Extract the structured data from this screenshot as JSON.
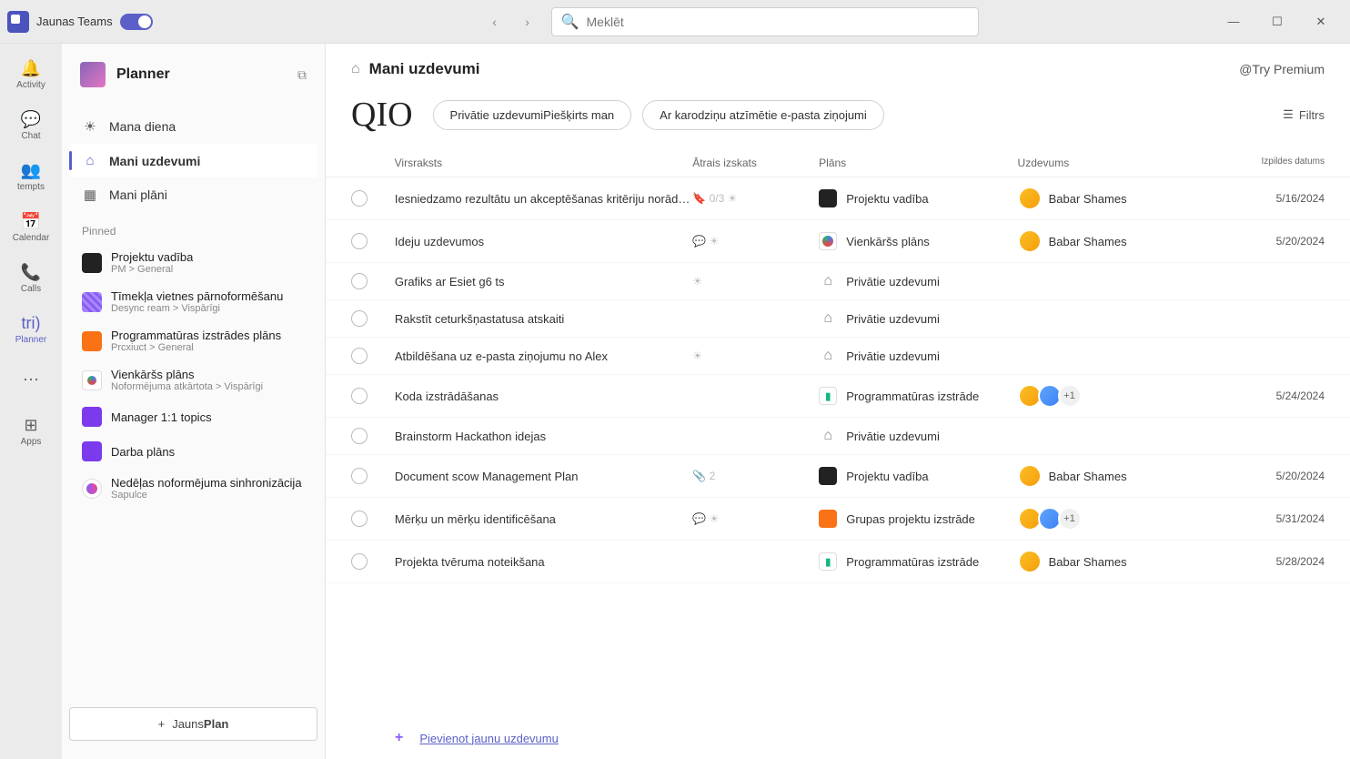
{
  "titlebar": {
    "teams_label": "Jaunas Teams",
    "search_placeholder": "Meklēt"
  },
  "rail": [
    {
      "label": "Activity",
      "icon": "🔔"
    },
    {
      "label": "Chat",
      "icon": "💬"
    },
    {
      "label": "tempts",
      "icon": "👥"
    },
    {
      "label": "Calendar",
      "icon": "📅"
    },
    {
      "label": "Calls",
      "icon": "📞"
    },
    {
      "label": "Planner",
      "icon": "tri)",
      "active": true
    },
    {
      "label": "",
      "icon": "⋯"
    },
    {
      "label": "Apps",
      "icon": "⊞"
    }
  ],
  "sidebar": {
    "title": "Planner",
    "nav": [
      {
        "label": "Mana diena",
        "icon": "☀"
      },
      {
        "label": "Mani uzdevumi",
        "icon": "⌂",
        "active": true
      },
      {
        "label": "Mani plāni",
        "icon": "▦"
      }
    ],
    "pinned_label": "Pinned",
    "pinned": [
      {
        "title": "Projektu vadība",
        "sub": "PM &gt; General",
        "cls": "black"
      },
      {
        "title": "Tīmekļa vietnes pārnoformēšanu",
        "sub": "Desync ream > Vispārīgi",
        "cls": "purple"
      },
      {
        "title": "Programmatūras izstrādes plāns",
        "sub": "Prcxiuct &gt; General",
        "cls": "orange"
      },
      {
        "title": "Vienkāršs plāns",
        "sub": "Noformējuma atkārtota &gt; Vispārīgi",
        "cls": "white"
      },
      {
        "title": "Manager 1:1 topics",
        "sub": "",
        "cls": "violet"
      },
      {
        "title": "Darba plāns",
        "sub": "",
        "cls": "violet"
      },
      {
        "title": "Nedēļas noformējuma sinhronizācija",
        "sub": "Sapulce",
        "cls": "circle"
      }
    ],
    "new_plan_prefix": "Jauns",
    "new_plan_suffix": "Plan"
  },
  "content": {
    "title": "Mani uzdevumi",
    "premium": "@Try Premium",
    "qio": "QIO",
    "pill1": "Privātie uzdevumiPiešķirts man",
    "pill2": "Ar karodziņu atzīmētie e-pasta ziņojumi",
    "filter": "Filtrs",
    "columns": {
      "title": "Virsraksts",
      "quick": "Ātrais izskats",
      "plan": "Plāns",
      "assign": "Uzdevums",
      "date": "Izpildes datums"
    },
    "tasks": [
      {
        "title": "Iesniedzamo rezultātu un akceptēšanas kritēriju norādīšana",
        "quick": "🔖 0/3 ☀",
        "plan": "Projektu vadība",
        "plan_cls": "black",
        "assignee": "Babar Shames",
        "avatars": 1,
        "date": "5/16/2024"
      },
      {
        "title": "Ideju uzdevumos",
        "quick": "💬 ☀",
        "plan": "Vienkāršs plāns",
        "plan_cls": "swirl",
        "assignee": "Babar Shames",
        "avatars": 1,
        "date": "5/20/2024"
      },
      {
        "title": "Grafiks ar Esiet g6 ts",
        "quick": "☀",
        "plan": "Privātie uzdevumi",
        "plan_cls": "home",
        "assignee": "",
        "avatars": 0,
        "date": ""
      },
      {
        "title": "Rakstīt ceturkšņastatusa atskaiti",
        "quick": "",
        "plan": "Privātie uzdevumi",
        "plan_cls": "home",
        "assignee": "",
        "avatars": 0,
        "date": ""
      },
      {
        "title": "Atbildēšana uz e-pasta ziņojumu no Alex",
        "quick": "☀",
        "plan": "Privātie uzdevumi",
        "plan_cls": "home",
        "assignee": "",
        "avatars": 0,
        "date": ""
      },
      {
        "title": "Koda izstrādāšanas",
        "quick": "",
        "plan": "Programmatūras izstrāde",
        "plan_cls": "green",
        "assignee": "",
        "avatars": 2,
        "more": "+1",
        "date": "5/24/2024"
      },
      {
        "title": "Brainstorm Hackathon idejas",
        "quick": "",
        "plan": "Privātie uzdevumi",
        "plan_cls": "home",
        "assignee": "",
        "avatars": 0,
        "date": ""
      },
      {
        "title": "Document scow Management Plan",
        "quick": "📎 2",
        "plan": "Projektu vadība",
        "plan_cls": "black",
        "assignee": "Babar Shames",
        "avatars": 1,
        "date": "5/20/2024"
      },
      {
        "title": "Mērķu un mērķu identificēšana",
        "quick": "💬 ☀",
        "plan": "Grupas projektu izstrāde",
        "plan_cls": "orange",
        "assignee": "",
        "avatars": 2,
        "more": "+1",
        "date": "5/31/2024"
      },
      {
        "title": "Projekta tvēruma noteikšana",
        "quick": "",
        "plan": "Programmatūras izstrāde",
        "plan_cls": "green",
        "assignee": "Babar Shames",
        "avatars": 1,
        "date": "5/28/2024"
      }
    ],
    "add_task": "Pievienot jaunu uzdevumu"
  }
}
